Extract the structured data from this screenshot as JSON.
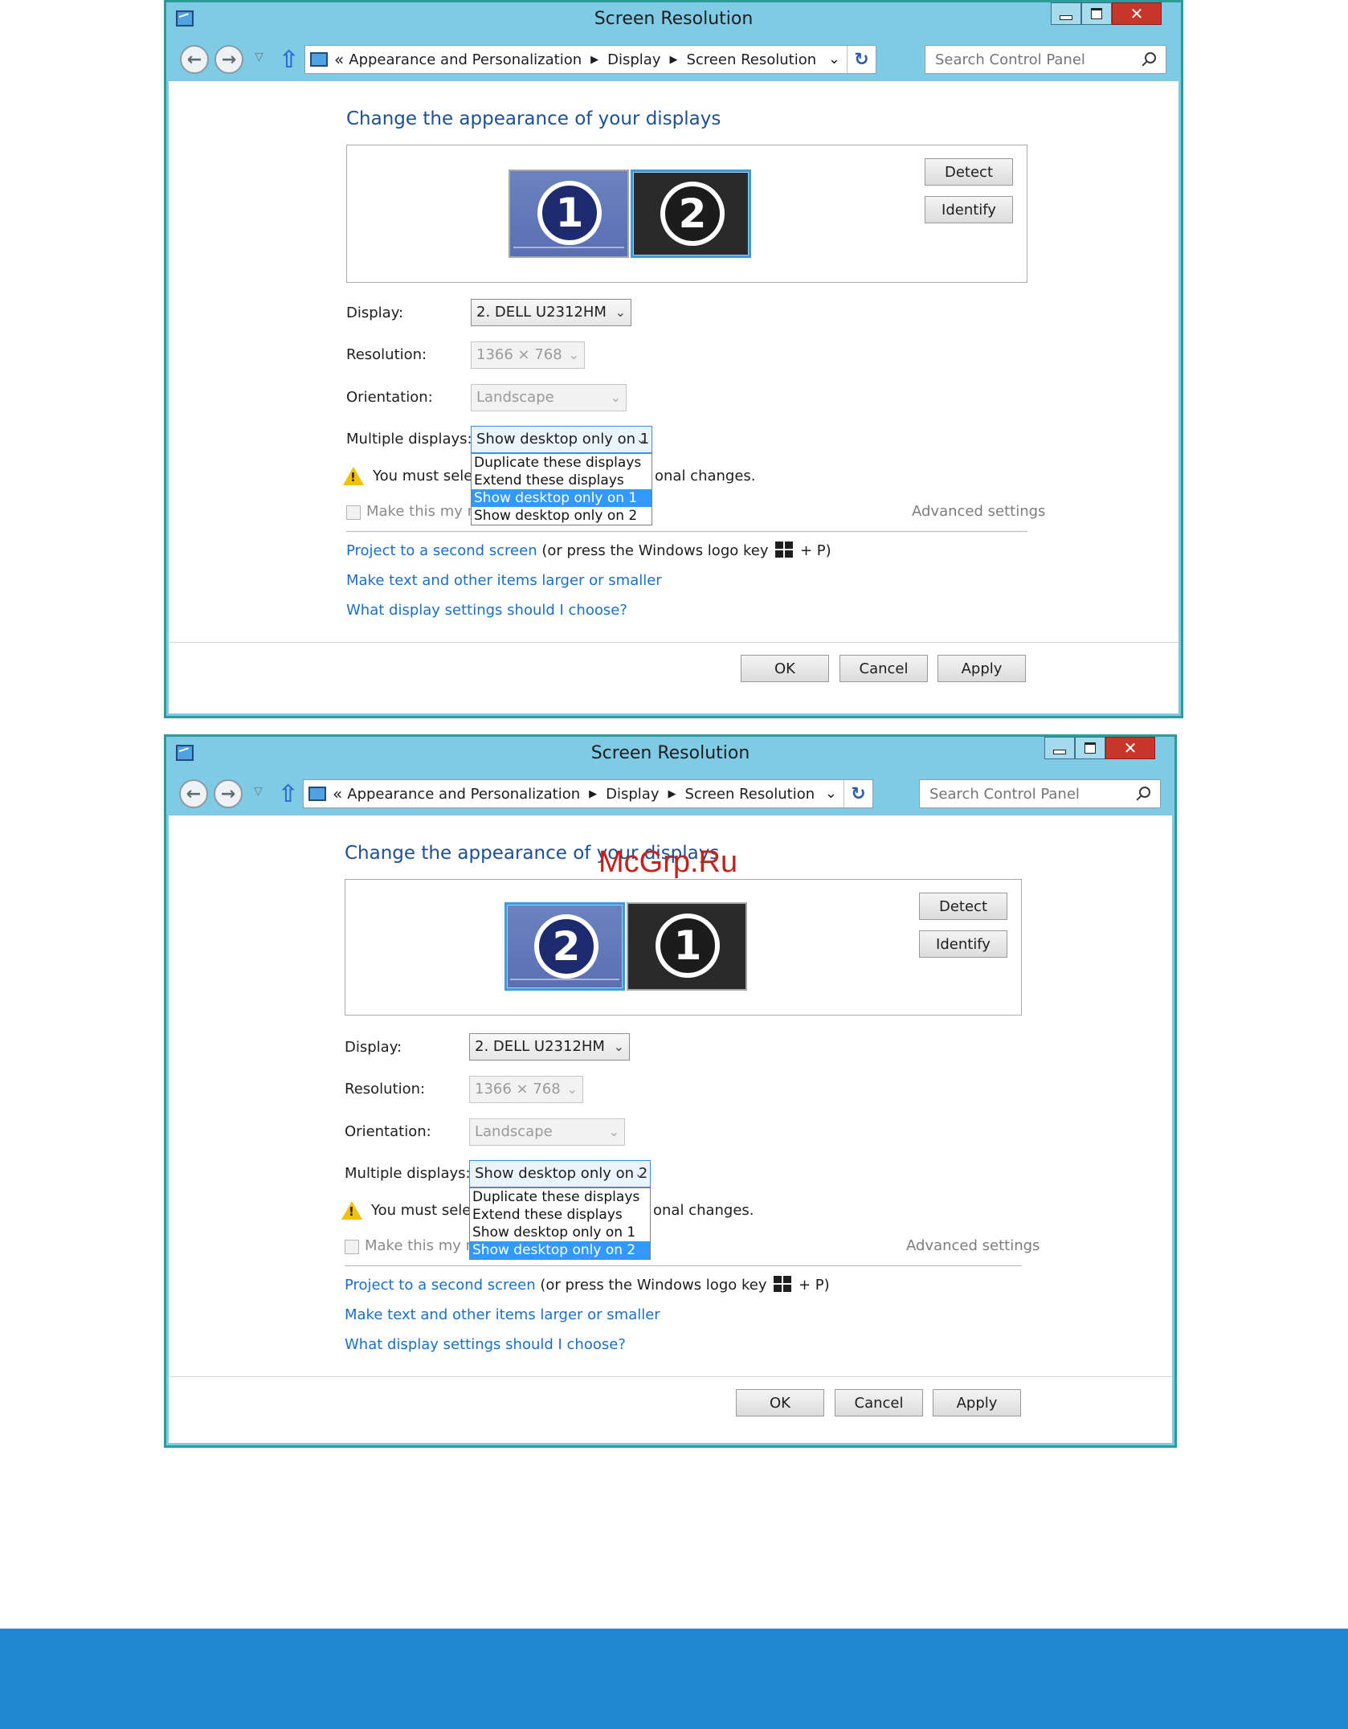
{
  "window_title": "Screen Resolution",
  "breadcrumb": {
    "overflow": "«",
    "items": [
      "Appearance and Personalization",
      "Display",
      "Screen Resolution"
    ]
  },
  "search": {
    "placeholder": "Search Control Panel"
  },
  "heading": "Change the appearance of your displays",
  "buttons": {
    "detect": "Detect",
    "identify": "Identify",
    "ok": "OK",
    "cancel": "Cancel",
    "apply": "Apply"
  },
  "labels": {
    "display": "Display:",
    "resolution": "Resolution:",
    "orientation": "Orientation:",
    "multiple": "Multiple displays:"
  },
  "values": {
    "display": "2. DELL U2312HM",
    "resolution": "1366 × 768",
    "orientation": "Landscape"
  },
  "dropdown_options": [
    "Duplicate these displays",
    "Extend these displays",
    "Show desktop only on 1",
    "Show desktop only on 2"
  ],
  "warning": {
    "left": "You must selec",
    "right": "onal changes."
  },
  "checkbox_label": "Make this my ma",
  "advanced_link": "Advanced settings",
  "links": {
    "project": "Project to a second screen",
    "project_suffix_before": " (or press the Windows logo key ",
    "project_suffix_after": " + P)",
    "text_size": "Make text and other items larger or smaller",
    "which_settings": "What display settings should I choose?"
  },
  "panels": [
    {
      "multiple_value": "Show desktop only on 1",
      "selected_option_index": 2,
      "monitors": [
        {
          "number": "1",
          "style": "light",
          "selected": false
        },
        {
          "number": "2",
          "style": "dark",
          "selected": true
        }
      ]
    },
    {
      "multiple_value": "Show desktop only on 2",
      "selected_option_index": 3,
      "monitors": [
        {
          "number": "2",
          "style": "light",
          "selected": true
        },
        {
          "number": "1",
          "style": "dark",
          "selected": false
        }
      ]
    }
  ],
  "watermark": "McGrp.Ru",
  "colors": {
    "window_chrome": "#7fcbe6",
    "window_border": "#2f9a9a",
    "heading": "#1e4f96",
    "link": "#1a6fcd",
    "selection": "#3399ff",
    "footer_band": "#2187d3"
  }
}
